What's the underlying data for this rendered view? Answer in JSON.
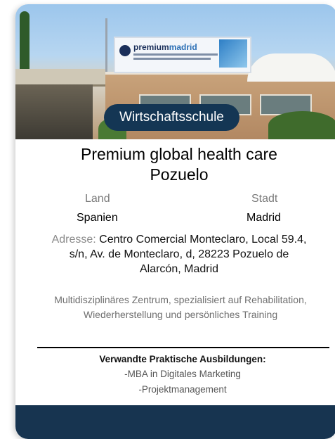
{
  "card": {
    "badge": "Wirtschaftsschule",
    "photo": {
      "billboard_brand": "premium",
      "billboard_brand_accent": "madrid"
    },
    "title": "Premium global health care Pozuelo",
    "country_label": "Land",
    "country_value": "Spanien",
    "city_label": "Stadt",
    "city_value": "Madrid",
    "address_label": "Adresse:",
    "address_value": "Centro Comercial Monteclaro, Local 59.4, s/n, Av. de Monteclaro, d, 28223 Pozuelo de Alarcón, Madrid",
    "description": "Multidisziplinäres Zentrum, spezialisiert auf Rehabilitation, Wiederherstellung und persönliches Training",
    "related_title": "Verwandte Praktische Ausbildungen:",
    "related_items": [
      "-MBA in Digitales Marketing",
      "-Projektmanagement"
    ]
  },
  "colors": {
    "badge_bg": "#143654",
    "footer_bg": "#173450",
    "label_gray": "#7a7a7a"
  }
}
